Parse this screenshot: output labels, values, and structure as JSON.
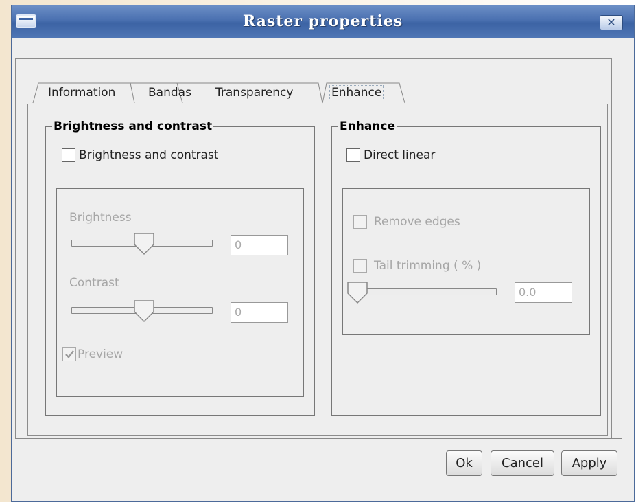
{
  "window": {
    "title": "Raster properties",
    "close_glyph": "✕"
  },
  "tabs": [
    {
      "label": "Information"
    },
    {
      "label": "Bandas"
    },
    {
      "label": "Transparency"
    },
    {
      "label": "Enhance",
      "active": true
    }
  ],
  "brightness_group": {
    "legend": "Brightness and contrast",
    "enable_checkbox": {
      "label": "Brightness and contrast",
      "checked": false
    },
    "brightness": {
      "label": "Brightness",
      "value": "0",
      "slider_level": 0.5
    },
    "contrast": {
      "label": "Contrast",
      "value": "0",
      "slider_level": 0.5
    },
    "preview": {
      "label": "Preview",
      "checked": true,
      "enabled": false
    }
  },
  "enhance_group": {
    "legend": "Enhance",
    "direct_linear": {
      "label": "Direct linear",
      "checked": false
    },
    "remove_edges": {
      "label": "Remove edges",
      "checked": false,
      "enabled": false
    },
    "tail_trimming": {
      "label": "Tail trimming ( % )",
      "checked": false,
      "enabled": false,
      "value": "0.0",
      "slider_level": 0.0
    }
  },
  "buttons": {
    "ok": "Ok",
    "cancel": "Cancel",
    "apply": "Apply"
  },
  "icons": {
    "window_menu": "window-menu-icon",
    "close": "close-icon",
    "slider_thumb": "slider-thumb-icon",
    "checkmark": "checkmark-icon"
  },
  "colors": {
    "titlebar": "#4a70b0",
    "window_bg": "#eeeeee",
    "disabled_text": "#a6a6a6"
  }
}
